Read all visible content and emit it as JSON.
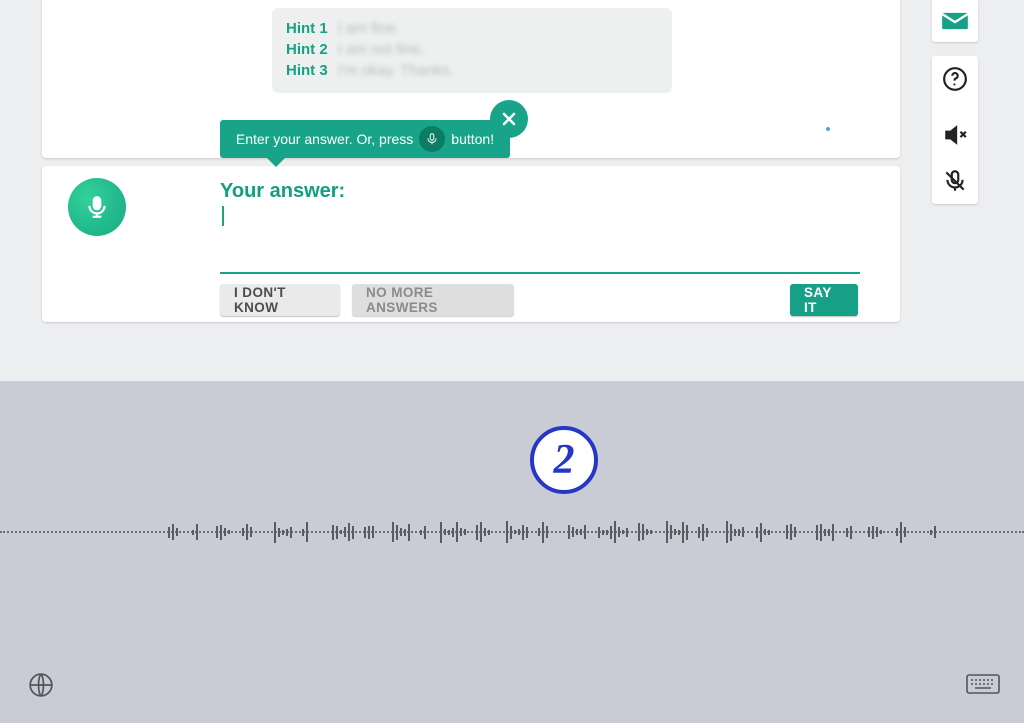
{
  "hints": {
    "label1": "Hint 1",
    "label2": "Hint 2",
    "label3": "Hint 3",
    "text1": "I am fine.",
    "text2": "I am not fine.",
    "text3": "I'm okay. Thanks."
  },
  "tooltip": {
    "before": "Enter your answer. Or, press",
    "after": "button!"
  },
  "answer": {
    "heading": "Your answer:",
    "value": ""
  },
  "buttons": {
    "idk": "I DON'T KNOW",
    "no_more": "NO MORE ANSWERS",
    "say_it": "SAY IT"
  },
  "recorder": {
    "countdown": "2"
  },
  "colors": {
    "accent": "#16a085",
    "recorder_bg": "#c9ccd5",
    "badge_blue": "#2637c4"
  }
}
